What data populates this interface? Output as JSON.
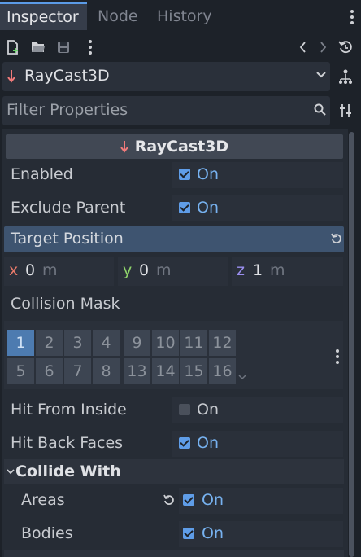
{
  "tabs": [
    {
      "label": "Inspector"
    },
    {
      "label": "Node"
    },
    {
      "label": "History"
    }
  ],
  "object": {
    "name": "RayCast3D"
  },
  "filter": {
    "placeholder": "Filter Properties"
  },
  "header": {
    "title": "RayCast3D"
  },
  "props": {
    "enabled": {
      "label": "Enabled",
      "value": "On",
      "checked": true
    },
    "exclude_parent": {
      "label": "Exclude Parent",
      "value": "On",
      "checked": true
    },
    "target_position": {
      "label": "Target Position",
      "x": {
        "axis": "x",
        "value": "0",
        "unit": "m"
      },
      "y": {
        "axis": "y",
        "value": "0",
        "unit": "m"
      },
      "z": {
        "axis": "z",
        "value": "1",
        "unit": "m"
      }
    },
    "collision_mask": {
      "label": "Collision Mask",
      "bits": [
        "1",
        "2",
        "3",
        "4",
        "5",
        "6",
        "7",
        "8",
        "9",
        "10",
        "11",
        "12",
        "13",
        "14",
        "15",
        "16"
      ],
      "active": [
        "1"
      ]
    },
    "hit_from_inside": {
      "label": "Hit From Inside",
      "value": "On",
      "checked": false
    },
    "hit_back_faces": {
      "label": "Hit Back Faces",
      "value": "On",
      "checked": true
    }
  },
  "collide_with": {
    "title": "Collide With",
    "areas": {
      "label": "Areas",
      "value": "On",
      "checked": true
    },
    "bodies": {
      "label": "Bodies",
      "value": "On",
      "checked": true
    }
  },
  "colors": {
    "accent": "#5f9de8",
    "on_text": "#77b2f0",
    "section_bg": "#3e5470",
    "axis_x": "#e87a6a",
    "axis_y": "#8fd46b",
    "axis_z": "#9b8ff0"
  },
  "icons": [
    "new-resource-icon",
    "open-folder-icon",
    "save-icon",
    "more-icon",
    "back-icon",
    "forward-icon",
    "history-icon",
    "node-type-icon",
    "dropdown-arrow-icon",
    "remote-icon",
    "search-icon",
    "tools-icon",
    "reset-icon",
    "chevron-down-icon"
  ]
}
